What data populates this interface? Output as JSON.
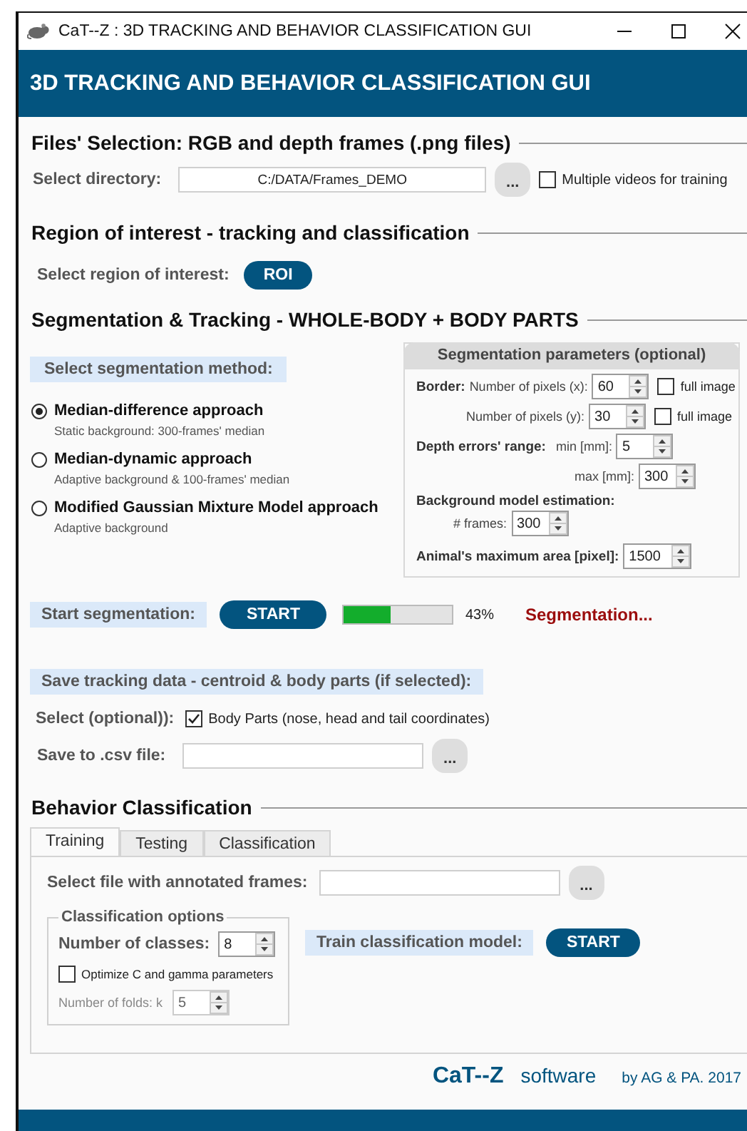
{
  "window": {
    "title": "CaT--Z : 3D TRACKING AND BEHAVIOR CLASSIFICATION GUI"
  },
  "header": {
    "title": "3D TRACKING AND BEHAVIOR CLASSIFICATION GUI"
  },
  "files": {
    "heading": "Files' Selection: RGB and depth frames (.png files)",
    "directory_label": "Select directory:",
    "directory_value": "C:/DATA/Frames_DEMO",
    "browse": "...",
    "multiple_videos": {
      "label": "Multiple videos for training",
      "checked": false
    }
  },
  "roi": {
    "heading": "Region of interest - tracking and classification",
    "label": "Select region of interest:",
    "button": "ROI"
  },
  "segmentation": {
    "heading": "Segmentation & Tracking - WHOLE-BODY + BODY PARTS",
    "method_label": "Select segmentation method:",
    "methods": [
      {
        "name": "Median-difference approach",
        "description": "Static background: 300-frames' median",
        "selected": true
      },
      {
        "name": "Median-dynamic approach",
        "description": "Adaptive background & 100-frames' median",
        "selected": false
      },
      {
        "name": "Modified Gaussian Mixture Model approach",
        "description": "Adaptive background",
        "selected": false
      }
    ],
    "parameters": {
      "title": "Segmentation parameters (optional)",
      "border": {
        "label": "Border:",
        "x": {
          "label": "Number of pixels (x):",
          "value": "60",
          "full_image": {
            "label": "full image",
            "checked": false
          }
        },
        "y": {
          "label": "Number of pixels (y):",
          "value": "30",
          "full_image": {
            "label": "full image",
            "checked": false
          }
        }
      },
      "depth": {
        "label": "Depth errors' range:",
        "min": {
          "label": "min [mm]:",
          "value": "5"
        },
        "max": {
          "label": "max [mm]:",
          "value": "300"
        }
      },
      "background": {
        "label": "Background model estimation:",
        "frames": {
          "label": "# frames:",
          "value": "300"
        }
      },
      "max_area": {
        "label": "Animal's maximum area [pixel]:",
        "value": "1500"
      }
    },
    "start_label": "Start segmentation:",
    "start_button": "START",
    "progress": {
      "level": 0.43,
      "reading": "43%"
    },
    "status": "Segmentation..."
  },
  "tracking_data": {
    "heading": "Save tracking data - centroid & body parts (if selected):",
    "select_label": "Select (optional)):",
    "body_parts": {
      "label": "Body Parts (nose, head and tail coordinates)",
      "checked": true
    },
    "csv_label": "Save to .csv file:",
    "browse": "..."
  },
  "behavior": {
    "heading": "Behavior Classification",
    "tabs": [
      {
        "label": "Training",
        "selected": true
      },
      {
        "label": "Testing",
        "selected": false
      },
      {
        "label": "Classification",
        "selected": false
      }
    ],
    "file_label": "Select file with annotated frames:",
    "browse": "...",
    "options": {
      "title": "Classification options",
      "classes_label": "Number of classes:",
      "classes_value": "8",
      "optimize": {
        "label": "Optimize C and gamma parameters",
        "checked": false
      },
      "folds": {
        "label": "Number of folds: k",
        "value": "5",
        "disabled": true
      }
    },
    "train_label": "Train classification model:",
    "train_button": "START"
  },
  "footer": {
    "brand": "CaT--Z",
    "product": "software",
    "credit": "by AG & PA. 2017"
  }
}
